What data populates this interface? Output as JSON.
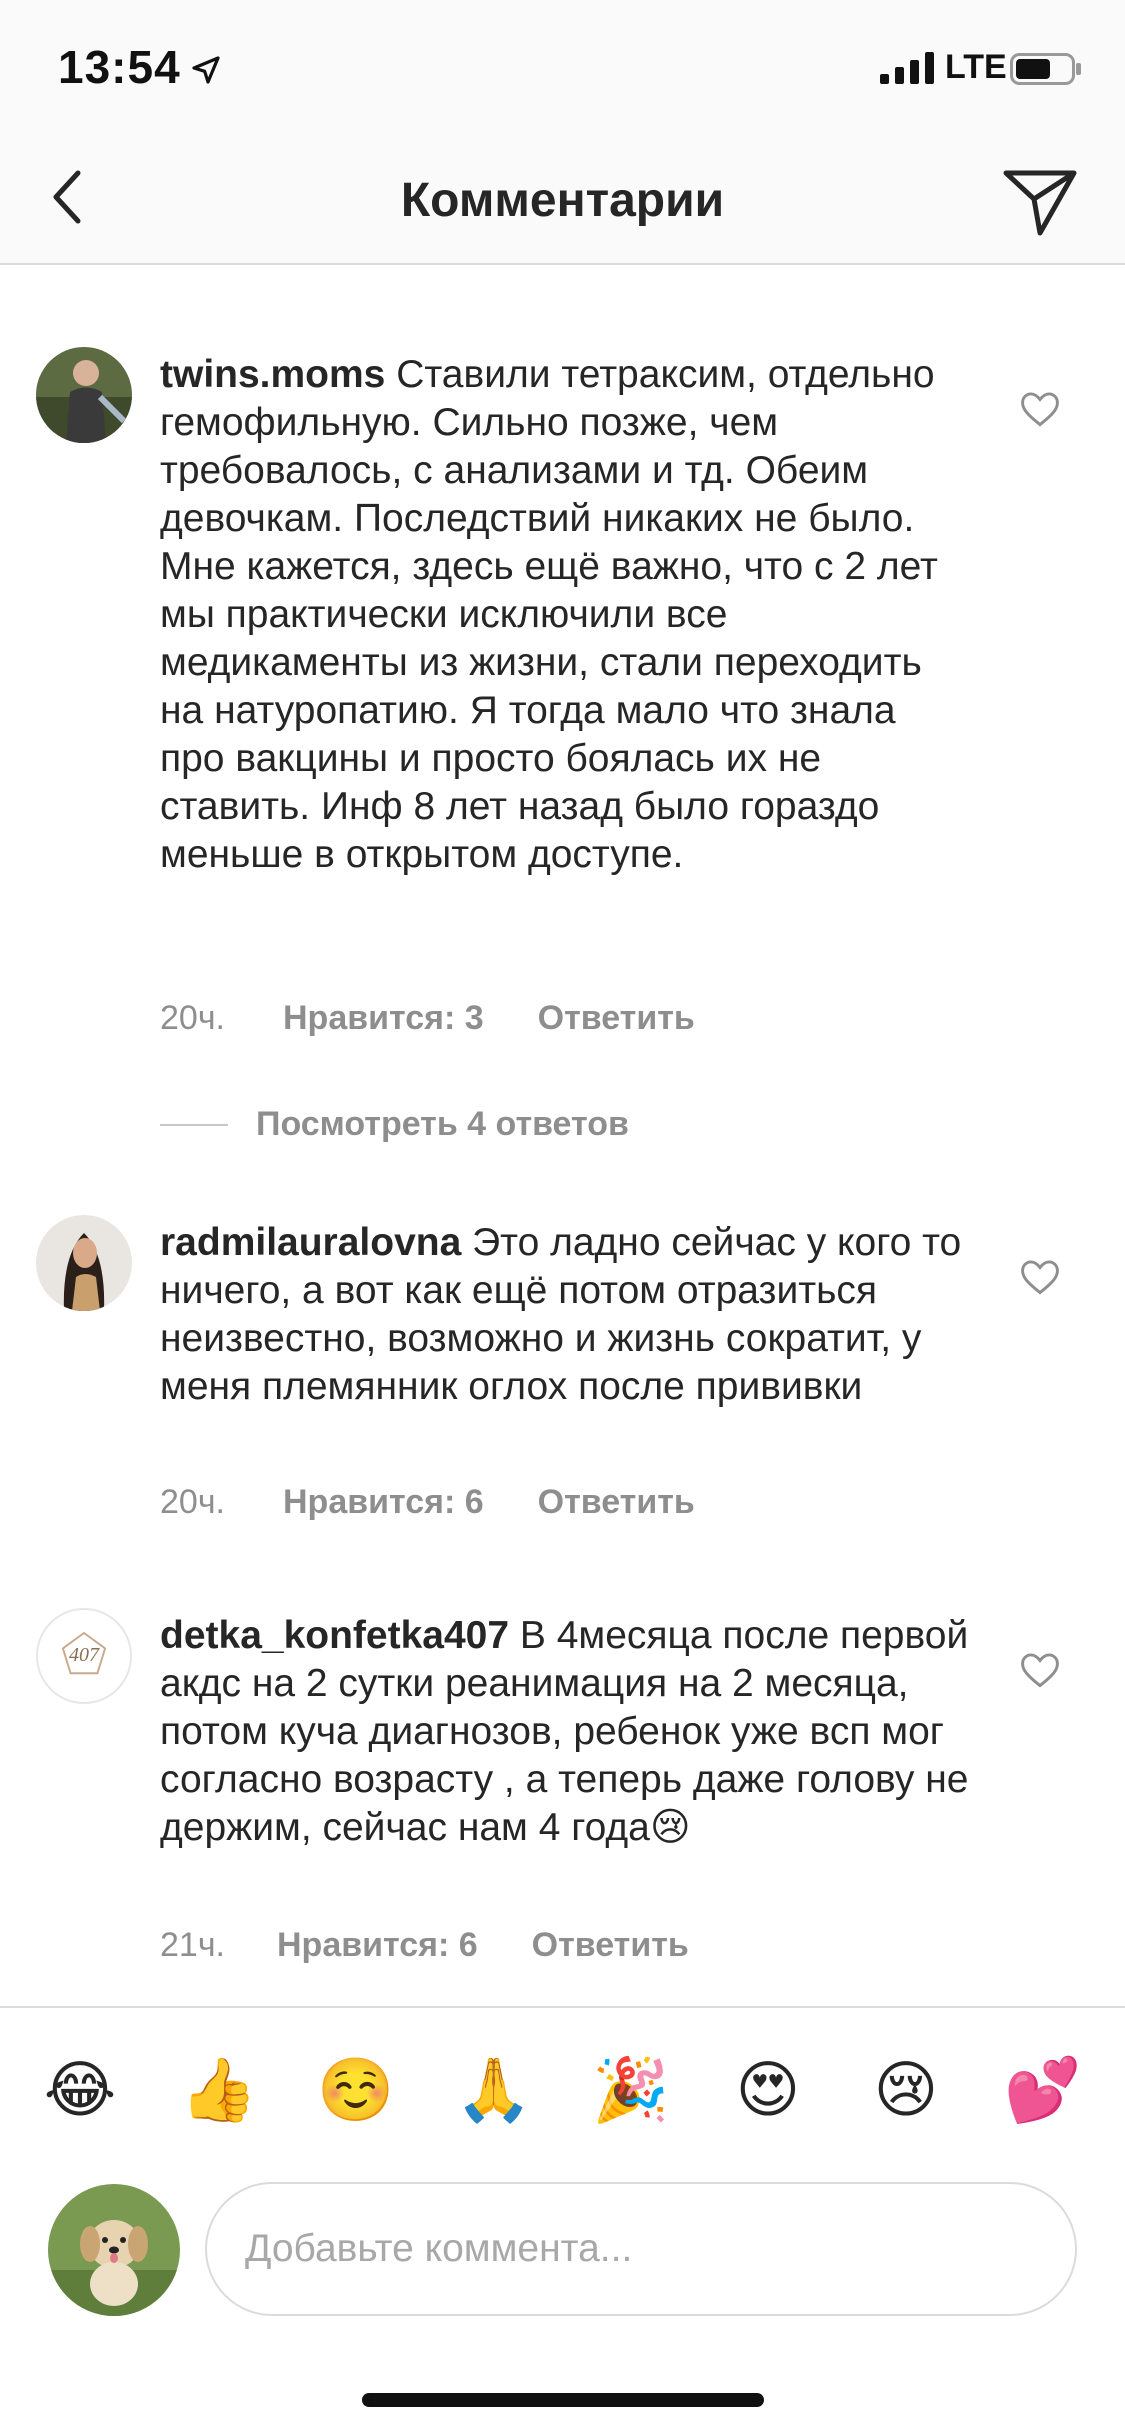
{
  "status_bar": {
    "time": "13:54",
    "network": "LTE"
  },
  "header": {
    "title": "Комментарии"
  },
  "comments": [
    {
      "username": "twins.moms",
      "text": "Ставили тетраксим, отдельно гемофильную. Сильно позже, чем требовалось, с анализами и тд. Обеим девочкам. Последствий никаких не было. Мне кажется, здесь ещё важно, что с 2 лет мы практически исключили все медикаменты из жизни, стали переходить на натуропатию. Я тогда мало что знала про вакцины и просто боялась их не ставить. Инф 8 лет назад было гораздо меньше в открытом доступе.",
      "time": "20ч.",
      "likes": "Нравится: 3",
      "reply": "Ответить"
    },
    {
      "username": "radmilauralovna",
      "text": "Это ладно сейчас у кого то ничего, а вот как ещё потом отразиться неизвестно, возможно и жизнь сократит, у меня племянник оглох после прививки",
      "time": "20ч.",
      "likes": "Нравится: 6",
      "reply": "Ответить"
    },
    {
      "username": "detka_konfetka407",
      "text": "В 4месяца после первой акдс на 2 сутки реанимация на 2 месяца,  потом куча диагнозов, ребенок уже всп мог согласно возрасту , а теперь даже голову не держим, сейчас нам 4 года😢",
      "time": "21ч.",
      "likes": "Нравится: 6",
      "reply": "Ответить"
    }
  ],
  "view_replies": "Посмотреть 4 ответов",
  "avatar_logo_text": "407",
  "emoji_bar": [
    "😂",
    "👍",
    "☺️",
    "🙏",
    "🎉",
    "😍",
    "😢",
    "💕"
  ],
  "composer": {
    "placeholder": "Добавьте коммента..."
  },
  "colors": {
    "text": "#262626",
    "secondary": "#8e8e8e",
    "divider": "#dbdbdb",
    "bar_bg": "#fafafa"
  },
  "icons": {
    "back": "chevron-left-icon",
    "send": "paper-plane-icon",
    "like": "heart-outline-icon",
    "location": "location-arrow-icon",
    "signal": "cellular-signal-icon",
    "battery": "battery-icon"
  }
}
